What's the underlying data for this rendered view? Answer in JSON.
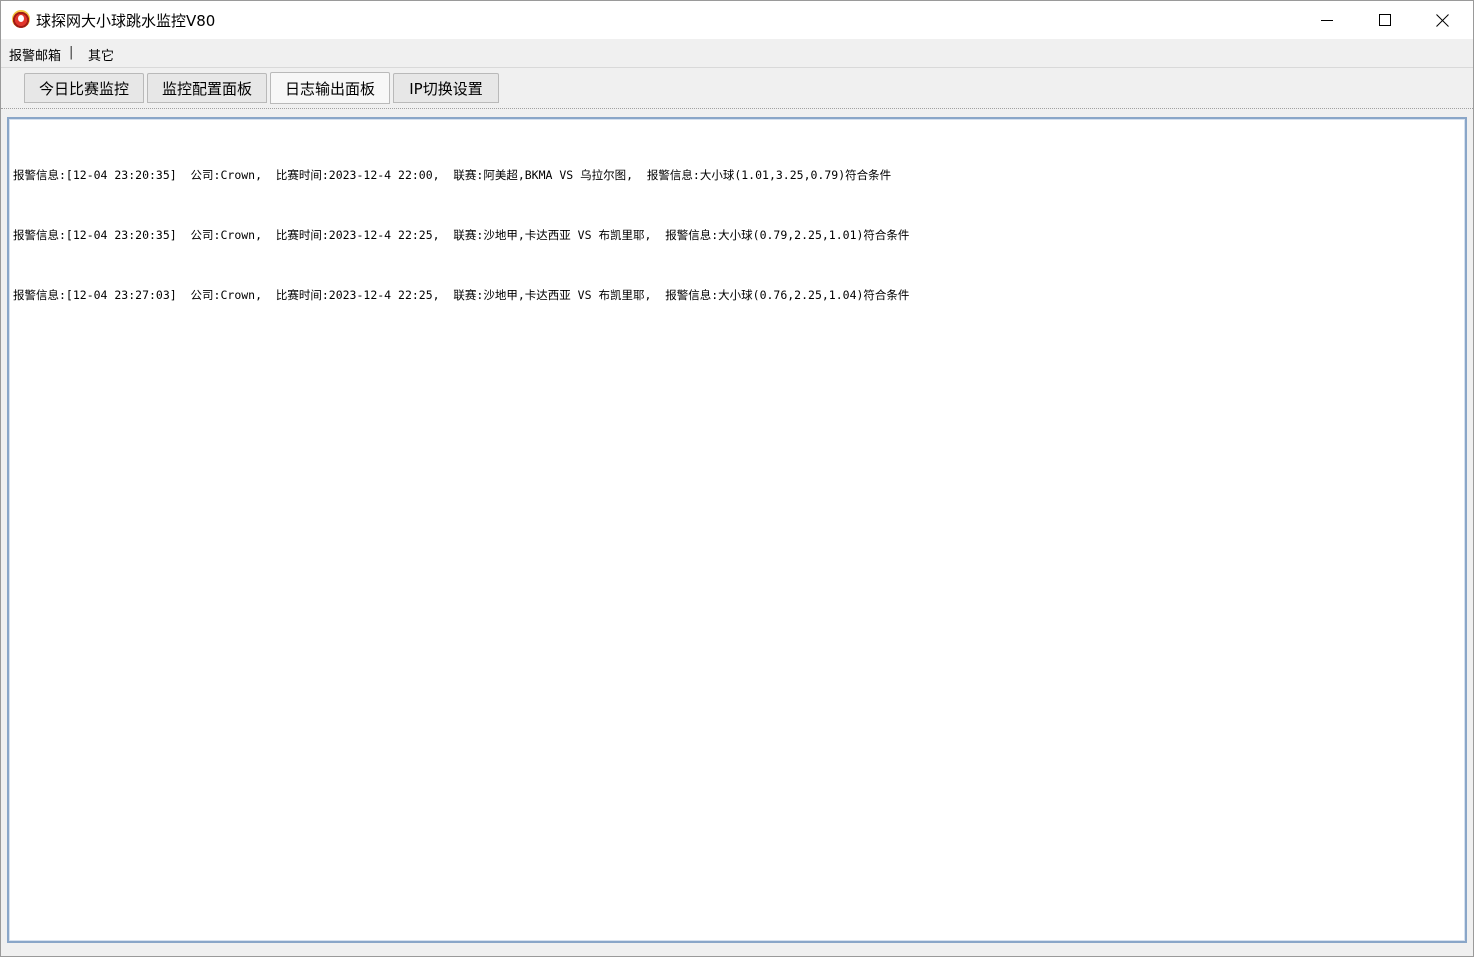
{
  "window": {
    "title": "球探网大小球跳水监控V80"
  },
  "menu": {
    "items": [
      {
        "label": "报警邮箱"
      },
      {
        "label": "|"
      },
      {
        "label": "其它"
      }
    ]
  },
  "tabs": [
    {
      "label": "今日比赛监控",
      "active": false
    },
    {
      "label": "监控配置面板",
      "active": false
    },
    {
      "label": "日志输出面板",
      "active": true
    },
    {
      "label": "IP切换设置",
      "active": false
    }
  ],
  "log": {
    "lines": [
      "报警信息:[12-04 23:20:35]  公司:Crown,  比赛时间:2023-12-4 22:00,  联赛:阿美超,BKMA VS 乌拉尔图,  报警信息:大小球(1.01,3.25,0.79)符合条件",
      "报警信息:[12-04 23:20:35]  公司:Crown,  比赛时间:2023-12-4 22:25,  联赛:沙地甲,卡达西亚 VS 布凯里耶,  报警信息:大小球(0.79,2.25,1.01)符合条件",
      "报警信息:[12-04 23:27:03]  公司:Crown,  比赛时间:2023-12-4 22:25,  联赛:沙地甲,卡达西亚 VS 布凯里耶,  报警信息:大小球(0.76,2.25,1.04)符合条件"
    ]
  }
}
